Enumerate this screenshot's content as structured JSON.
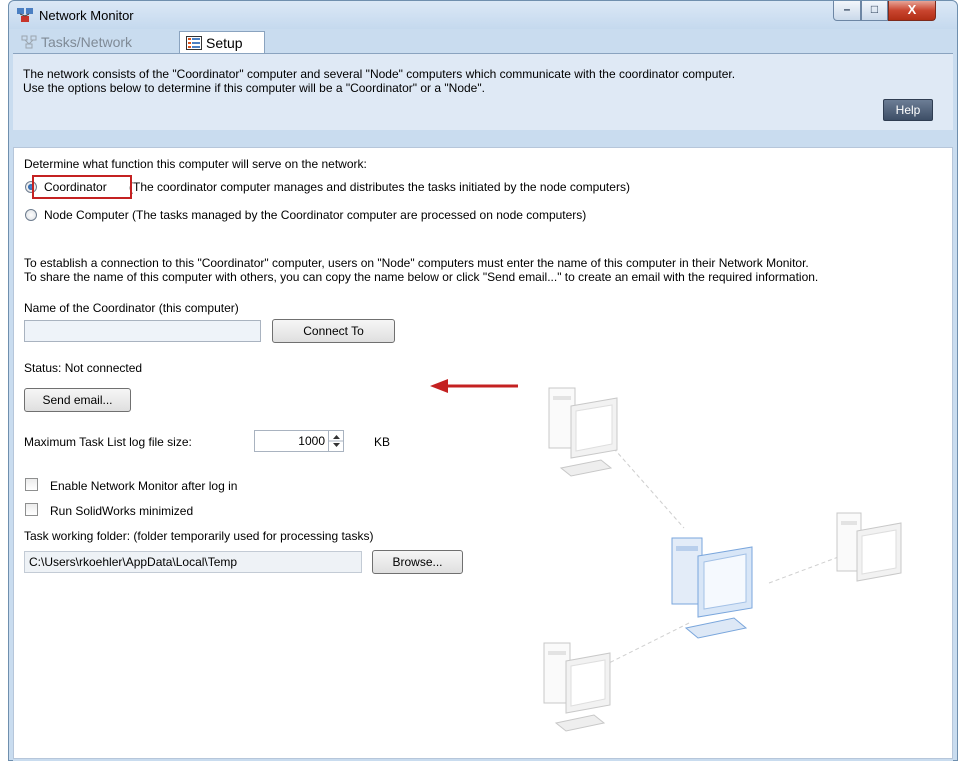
{
  "window": {
    "title": "Network Monitor",
    "controls": {
      "minimize": "–",
      "maximize": "□",
      "close": "X"
    }
  },
  "tabs": [
    {
      "label": "Tasks/Network",
      "active": false
    },
    {
      "label": "Setup",
      "active": true
    }
  ],
  "info": {
    "line1": "The network consists of the \"Coordinator\" computer and several \"Node\" computers which communicate with the coordinator computer.",
    "line2": "Use the options below to determine if this computer will be a \"Coordinator\" or a \"Node\".",
    "help_label": "Help"
  },
  "function": {
    "prompt": "Determine what function this computer will serve on the network:",
    "coordinator_label": "Coordinator",
    "coordinator_desc": "(The coordinator computer manages and distributes the tasks initiated by the node computers)",
    "coordinator_selected": true,
    "node_label": "Node Computer (The tasks managed by the Coordinator computer are processed on node computers)",
    "node_selected": false
  },
  "connection": {
    "line1": "To establish a connection to this \"Coordinator\" computer, users on \"Node\" computers must enter the name of this computer in their Network Monitor.",
    "line2": "To share the name of this computer with others, you can copy the name below or click \"Send email...\" to create an email with the required information.",
    "name_label": "Name of the Coordinator (this computer)",
    "name_value": "",
    "connect_label": "Connect To",
    "status": "Status: Not connected",
    "send_email_label": "Send email..."
  },
  "log": {
    "label": "Maximum Task List log file size:",
    "value": "1000",
    "unit": "KB"
  },
  "options": [
    {
      "label": "Enable Network Monitor after log in",
      "checked": false
    },
    {
      "label": "Run SolidWorks minimized",
      "checked": false
    }
  ],
  "folder": {
    "label": "Task working folder: (folder temporarily used for processing tasks)",
    "value": "C:\\Users\\rkoehler\\AppData\\Local\\Temp",
    "browse_label": "Browse..."
  },
  "colors": {
    "accent_red": "#c42121",
    "highlight_blue": "#7aa6dc"
  }
}
